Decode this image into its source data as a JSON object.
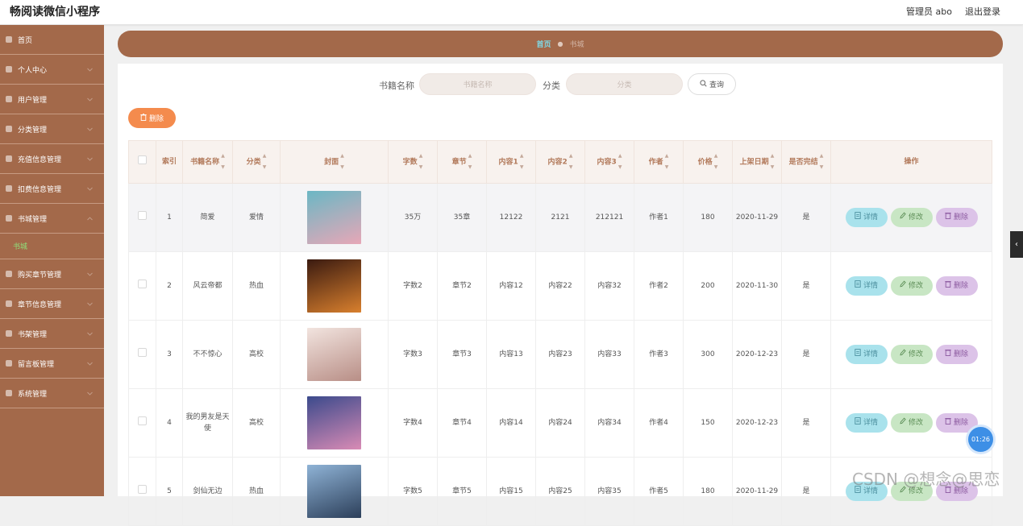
{
  "header": {
    "title": "畅阅读微信小程序",
    "user_label": "管理员 abo",
    "logout_label": "退出登录"
  },
  "sidebar": {
    "items": [
      {
        "label": "首页",
        "icon": "home-icon"
      },
      {
        "label": "个人中心",
        "icon": "user-icon"
      },
      {
        "label": "用户管理",
        "icon": "users-icon"
      },
      {
        "label": "分类管理",
        "icon": "category-icon"
      },
      {
        "label": "充值信息管理",
        "icon": "recharge-icon"
      },
      {
        "label": "扣费信息管理",
        "icon": "deduction-icon"
      },
      {
        "label": "书城管理",
        "icon": "bookstore-icon",
        "expanded": true,
        "sub": "书城"
      },
      {
        "label": "购买章节管理",
        "icon": "purchase-icon"
      },
      {
        "label": "章节信息管理",
        "icon": "chapter-icon"
      },
      {
        "label": "书架管理",
        "icon": "bookshelf-icon"
      },
      {
        "label": "留言板管理",
        "icon": "message-icon"
      },
      {
        "label": "系统管理",
        "icon": "system-icon"
      }
    ]
  },
  "breadcrumb": {
    "home": "首页",
    "current": "书城"
  },
  "search": {
    "name_label": "书籍名称",
    "name_placeholder": "书籍名称",
    "category_label": "分类",
    "category_placeholder": "分类",
    "query_label": "查询"
  },
  "toolbar": {
    "delete_label": "删除"
  },
  "table": {
    "headers": [
      "索引",
      "书籍名称",
      "分类",
      "封面",
      "字数",
      "章节",
      "内容1",
      "内容2",
      "内容3",
      "作者",
      "价格",
      "上架日期",
      "是否完结",
      "操作"
    ],
    "rows": [
      {
        "index": "1",
        "name": "简爱",
        "category": "爱情",
        "words": "35万",
        "chapter": "35章",
        "c1": "12122",
        "c2": "2121",
        "c3": "212121",
        "author": "作者1",
        "price": "180",
        "date": "2020-11-29",
        "finished": "是",
        "cover_colors": [
          "#6bb7c4",
          "#e7a7b7"
        ]
      },
      {
        "index": "2",
        "name": "风云帝都",
        "category": "热血",
        "words": "字数2",
        "chapter": "章节2",
        "c1": "内容12",
        "c2": "内容22",
        "c3": "内容32",
        "author": "作者2",
        "price": "200",
        "date": "2020-11-30",
        "finished": "是",
        "cover_colors": [
          "#3a1a10",
          "#d9802e"
        ]
      },
      {
        "index": "3",
        "name": "不不惊心",
        "category": "高校",
        "words": "字数3",
        "chapter": "章节3",
        "c1": "内容13",
        "c2": "内容23",
        "c3": "内容33",
        "author": "作者3",
        "price": "300",
        "date": "2020-12-23",
        "finished": "是",
        "cover_colors": [
          "#f2e4df",
          "#b88e86"
        ]
      },
      {
        "index": "4",
        "name": "我的男友是天使",
        "category": "高校",
        "words": "字数4",
        "chapter": "章节4",
        "c1": "内容14",
        "c2": "内容24",
        "c3": "内容34",
        "author": "作者4",
        "price": "150",
        "date": "2020-12-23",
        "finished": "是",
        "cover_colors": [
          "#3b4a8c",
          "#d98bb5"
        ]
      },
      {
        "index": "5",
        "name": "剑仙无边",
        "category": "热血",
        "words": "字数5",
        "chapter": "章节5",
        "c1": "内容15",
        "c2": "内容25",
        "c3": "内容35",
        "author": "作者5",
        "price": "180",
        "date": "2020-11-29",
        "finished": "是",
        "cover_colors": [
          "#8fb3d6",
          "#2c3f5a"
        ]
      }
    ],
    "actions": {
      "detail": "详情",
      "edit": "修改",
      "delete": "删除"
    }
  },
  "timer": "01:26",
  "watermark": "CSDN @想念@思恋",
  "colors": {
    "sidebar": "#a3694a",
    "delete": "#f48b4d",
    "detail": "#a9e2ec",
    "edit": "#c8e6c4",
    "remove": "#dcc3e8",
    "breadcrumb_home": "#7fd9e6"
  }
}
